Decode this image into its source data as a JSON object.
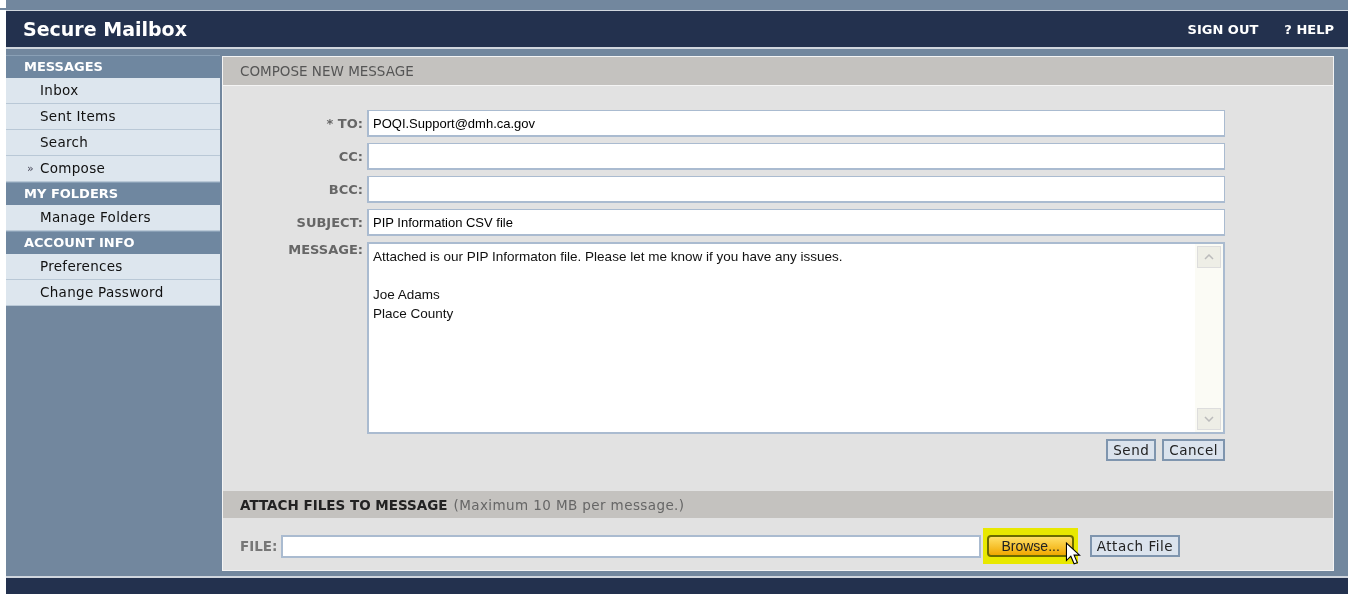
{
  "header": {
    "title": "Secure Mailbox",
    "links": [
      "SIGN OUT",
      "? HELP"
    ]
  },
  "sidebar": {
    "selected_marker": "»",
    "sections": [
      {
        "title": "MESSAGES",
        "items": [
          {
            "label": "Inbox",
            "selected": false
          },
          {
            "label": "Sent Items",
            "selected": false
          },
          {
            "label": "Search",
            "selected": false
          },
          {
            "label": "Compose",
            "selected": true
          }
        ]
      },
      {
        "title": "MY FOLDERS",
        "items": [
          {
            "label": "Manage Folders",
            "selected": false
          }
        ]
      },
      {
        "title": "ACCOUNT INFO",
        "items": [
          {
            "label": "Preferences",
            "selected": false
          },
          {
            "label": "Change Password",
            "selected": false
          }
        ]
      }
    ]
  },
  "compose": {
    "title": "COMPOSE NEW MESSAGE",
    "fields": [
      {
        "kind": "input",
        "label": "* TO:",
        "value": "POQI.Support@dmh.ca.gov"
      },
      {
        "kind": "input",
        "label": "CC:"
      },
      {
        "kind": "input",
        "label": "BCC:"
      },
      {
        "kind": "input",
        "label": "SUBJECT:",
        "value": "PIP Information CSV file"
      },
      {
        "kind": "textarea",
        "label": "MESSAGE:",
        "value": "Attached is our PIP Informaton file. Please let me know if you have any issues.\n\nJoe Adams\nPlace County"
      }
    ],
    "buttons": [
      "Send",
      "Cancel"
    ]
  },
  "attach": {
    "title": "ATTACH FILES TO MESSAGE",
    "note": "(Maximum 10 MB per message.)",
    "file_label": "FILE:",
    "browse": {
      "label": "Browse...",
      "highlighted": true
    },
    "attach_button": "Attach File"
  }
}
